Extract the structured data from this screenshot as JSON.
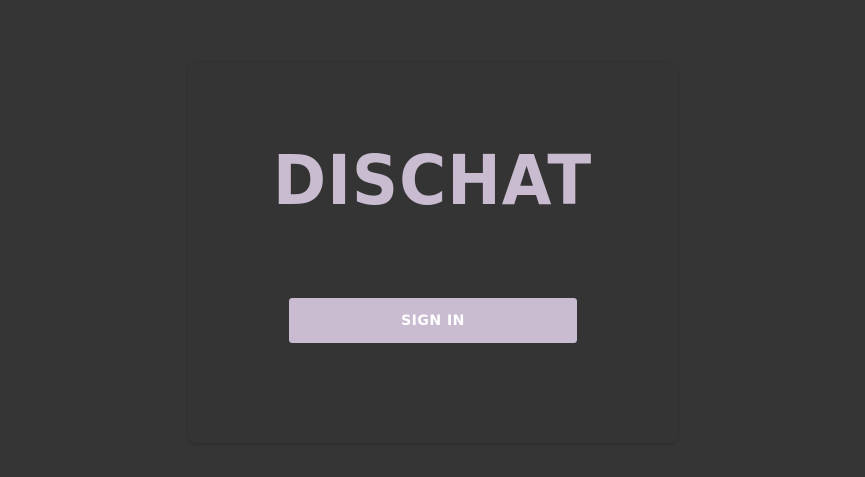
{
  "app": {
    "logo_text": "DISCHAT"
  },
  "auth": {
    "signin_label": "SIGN IN"
  },
  "colors": {
    "background": "#353535",
    "accent": "#c9bbd0",
    "button_text": "#ffffff"
  }
}
